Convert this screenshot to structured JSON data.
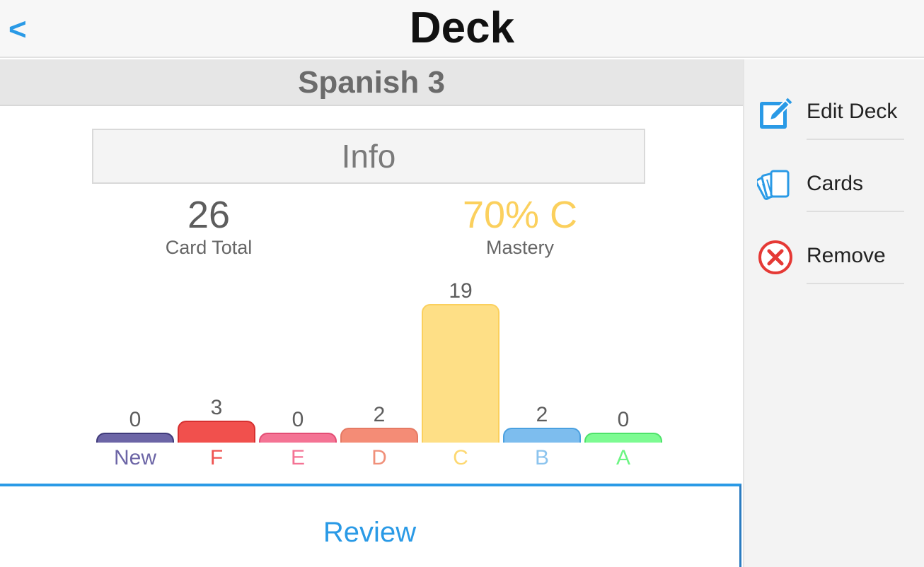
{
  "header": {
    "back_label": "<",
    "title": "Deck"
  },
  "deck": {
    "name": "Spanish 3",
    "info_label": "Info",
    "card_total_value": "26",
    "card_total_label": "Card Total",
    "mastery_value": "70% C",
    "mastery_label": "Mastery"
  },
  "chart_data": {
    "type": "bar",
    "categories": [
      "New",
      "F",
      "E",
      "D",
      "C",
      "B",
      "A"
    ],
    "values": [
      0,
      3,
      0,
      2,
      19,
      2,
      0
    ],
    "value_labels": [
      "0",
      "3",
      "0",
      "2",
      "19",
      "2",
      "0"
    ],
    "colors": {
      "New": {
        "fill": "#6c65a6",
        "stroke": "#3f3a7a",
        "label": "#6c65a6"
      },
      "F": {
        "fill": "#f1504d",
        "stroke": "#d63030",
        "label": "#ef5350"
      },
      "E": {
        "fill": "#f47394",
        "stroke": "#e34d74",
        "label": "#f47394"
      },
      "D": {
        "fill": "#f48c76",
        "stroke": "#e57a64",
        "label": "#f0907a"
      },
      "C": {
        "fill": "#fedf86",
        "stroke": "#fbd05d",
        "label": "#fdd871"
      },
      "B": {
        "fill": "#7dbdee",
        "stroke": "#4aa0e0",
        "label": "#8cc4ee"
      },
      "A": {
        "fill": "#7dfb92",
        "stroke": "#4ee26a",
        "label": "#6cf583"
      }
    },
    "ylim": [
      0,
      19
    ]
  },
  "actions": {
    "review_label": "Review"
  },
  "sidebar": {
    "items": [
      {
        "label": "Edit Deck",
        "icon": "edit-icon",
        "color": "#2a9ae6"
      },
      {
        "label": "Cards",
        "icon": "cards-icon",
        "color": "#2a9ae6"
      },
      {
        "label": "Remove",
        "icon": "remove-icon",
        "color": "#e53935"
      }
    ]
  }
}
